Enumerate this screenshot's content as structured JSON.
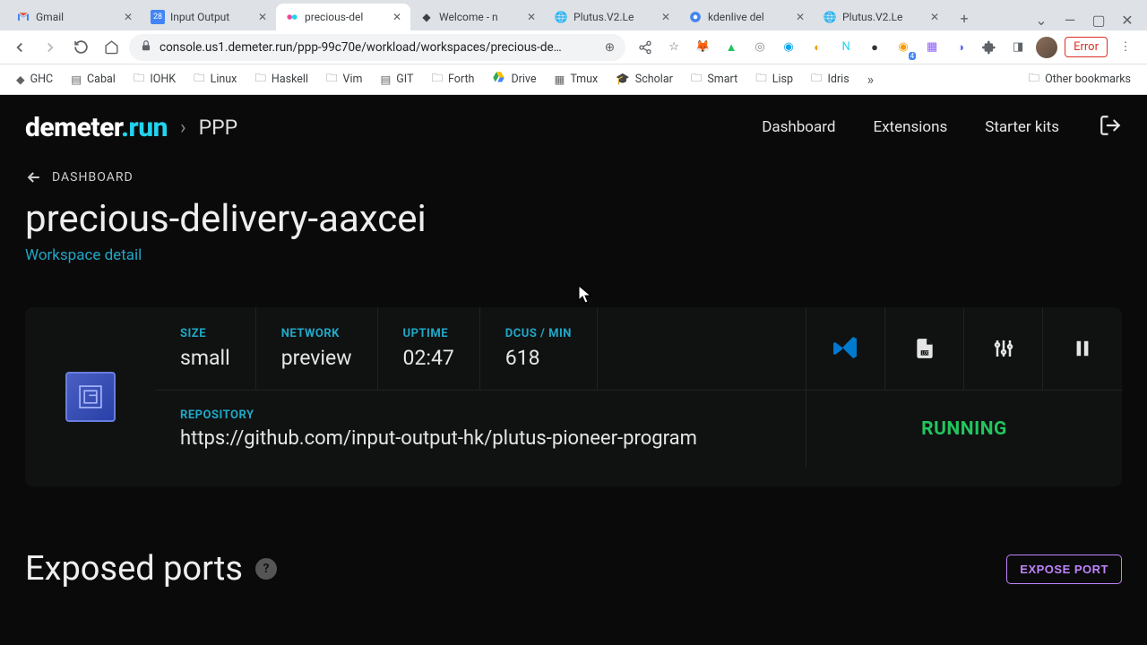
{
  "browser": {
    "tabs": [
      {
        "title": "Gmail",
        "active": false
      },
      {
        "title": "Input Output",
        "active": false
      },
      {
        "title": "precious-del",
        "active": true
      },
      {
        "title": "Welcome - n",
        "active": false
      },
      {
        "title": "Plutus.V2.Le",
        "active": false
      },
      {
        "title": "kdenlive del",
        "active": false
      },
      {
        "title": "Plutus.V2.Le",
        "active": false
      }
    ],
    "url": "console.us1.demeter.run/ppp-99c70e/workload/workspaces/precious-de…",
    "error_label": "Error",
    "bookmarks": [
      "GHC",
      "Cabal",
      "IOHK",
      "Linux",
      "Haskell",
      "Vim",
      "GIT",
      "Forth",
      "Drive",
      "Tmux",
      "Scholar",
      "Smart",
      "Lisp",
      "Idris"
    ],
    "other_bookmarks": "Other bookmarks"
  },
  "app": {
    "brand_white": "demeter",
    "brand_cyan": ".run",
    "breadcrumb": "PPP",
    "nav": {
      "dashboard": "Dashboard",
      "extensions": "Extensions",
      "starter_kits": "Starter kits"
    },
    "back_label": "DASHBOARD",
    "page_title": "precious-delivery-aaxcei",
    "sub_link": "Workspace detail",
    "stats": {
      "size": {
        "label": "SIZE",
        "value": "small"
      },
      "network": {
        "label": "NETWORK",
        "value": "preview"
      },
      "uptime": {
        "label": "UPTIME",
        "value": "02:47"
      },
      "dcus": {
        "label": "DCUS / MIN",
        "value": "618"
      }
    },
    "repo": {
      "label": "REPOSITORY",
      "url": "https://github.com/input-output-hk/plutus-pioneer-program"
    },
    "status": "RUNNING",
    "ports_title": "Exposed ports",
    "expose_btn": "EXPOSE PORT"
  }
}
